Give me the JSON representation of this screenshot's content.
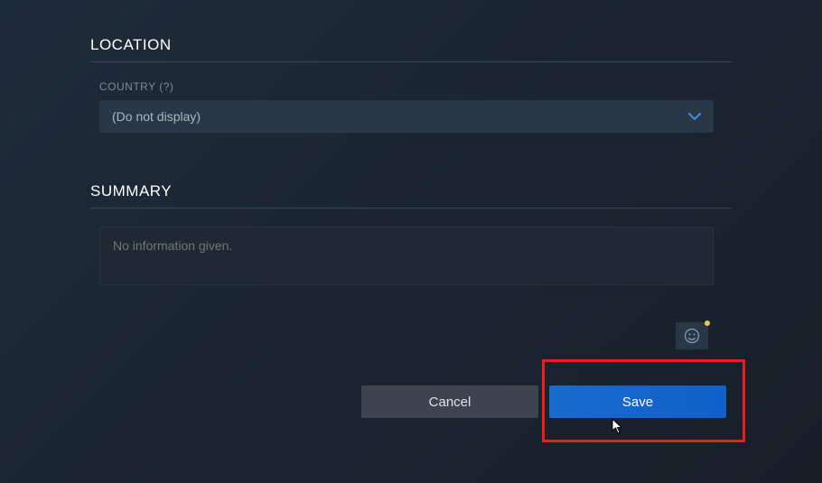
{
  "location": {
    "header": "LOCATION",
    "country_label": "COUNTRY (?)",
    "country_value": "(Do not display)"
  },
  "summary": {
    "header": "SUMMARY",
    "placeholder": "No information given."
  },
  "buttons": {
    "cancel": "Cancel",
    "save": "Save"
  }
}
